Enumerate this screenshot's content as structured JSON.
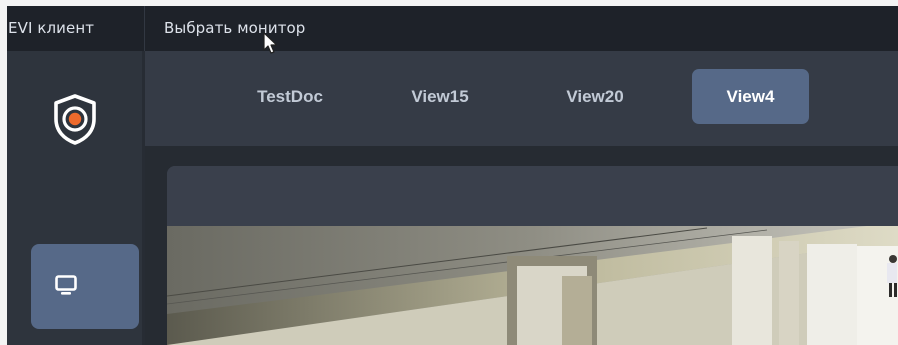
{
  "menubar": {
    "items": [
      {
        "label": "EVI клиент"
      },
      {
        "label": "Выбрать монитор"
      }
    ]
  },
  "sidebar": {
    "logo_icon": "shield-camera-logo-icon",
    "items": [
      {
        "icon": "monitor-icon",
        "active": true
      }
    ]
  },
  "tabs": [
    {
      "label": "TestDoc",
      "active": false
    },
    {
      "label": "View15",
      "active": false
    },
    {
      "label": "View20",
      "active": false
    },
    {
      "label": "View4",
      "active": true
    }
  ],
  "colors": {
    "background": "#2a3038",
    "menubar": "#1e2229",
    "accent": "#566988",
    "logo_orange": "#ee6a2c"
  }
}
